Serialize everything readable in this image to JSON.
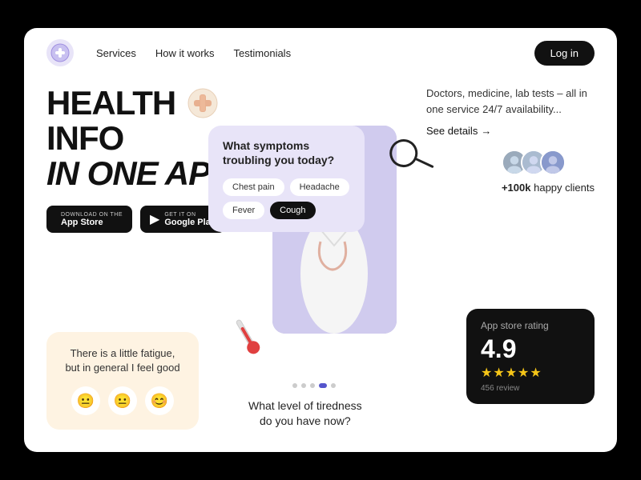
{
  "nav": {
    "logo_emoji": "🏥",
    "links": [
      "Services",
      "How it works",
      "Testimonials"
    ],
    "login_label": "Log in"
  },
  "hero": {
    "title_line1": "HEALTH",
    "title_cross": "✚",
    "title_line1_end": "INFO",
    "title_line2": "IN ONE APP",
    "description": "Doctors, medicine, lab tests – all in one service 24/7 availability...",
    "see_details": "See details",
    "arrow": "→"
  },
  "store_buttons": [
    {
      "sub": "Download on the",
      "name": "App Store",
      "icon": ""
    },
    {
      "sub": "GET IT ON",
      "name": "Google Play",
      "icon": "▶"
    }
  ],
  "fatigue_card": {
    "text": "There is a little fatigue, but in general I feel good",
    "emojis": [
      "😐",
      "😐",
      "😊"
    ]
  },
  "symptoms_card": {
    "title": "What symptoms troubling you today?",
    "tags": [
      "Chest pain",
      "Headache",
      "Fever",
      "Cough"
    ],
    "active_tag": "Cough"
  },
  "tiredness": {
    "line1": "What level of tiredness",
    "line2": "do you have now?"
  },
  "pagination": {
    "dots": 5,
    "active": 3
  },
  "clients": {
    "count": "+100k",
    "label": "happy clients"
  },
  "rating": {
    "title": "App store rating",
    "score": "4.9",
    "stars": "★★★★★",
    "review_count": "456 review"
  }
}
